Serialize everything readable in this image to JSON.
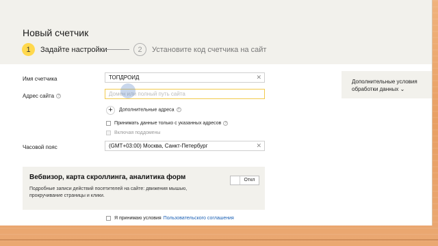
{
  "page": {
    "title": "Новый счетчик"
  },
  "steps": [
    {
      "num": "1",
      "label": "Задайте настройки"
    },
    {
      "num": "2",
      "label": "Установите код счетчика на сайт"
    }
  ],
  "form": {
    "name": {
      "label": "Имя счетчика",
      "value": "ТОПДРОИД"
    },
    "site": {
      "label": "Адрес сайта",
      "placeholder": "Домен или полный путь сайта"
    },
    "extra_addresses": {
      "icon": "plus-icon",
      "label": "Дополнительные адреса"
    },
    "only_listed": {
      "label": "Принимать данные только с указанных адресов",
      "checked": false
    },
    "subdomains": {
      "label": "Включая поддомены",
      "checked": false,
      "disabled": true
    },
    "timezone": {
      "label": "Часовой пояс",
      "value": "(GMT+03:00) Москва, Санкт-Петербург"
    }
  },
  "webvisor": {
    "title": "Вебвизор, карта скроллинга, аналитика форм",
    "description": "Подробные записи действий посетителей на сайте: движения мышью, прокручивание страницы и клики.",
    "toggle_label": "Откл"
  },
  "agreement": {
    "prefix": "Я принимаю условия",
    "link": "Пользовательского соглашения"
  },
  "side": {
    "text": "Дополнительные условия обработки данных"
  },
  "colors": {
    "accent": "#ffd84d",
    "link": "#1a5fb4",
    "focus": "#f2c94c"
  }
}
